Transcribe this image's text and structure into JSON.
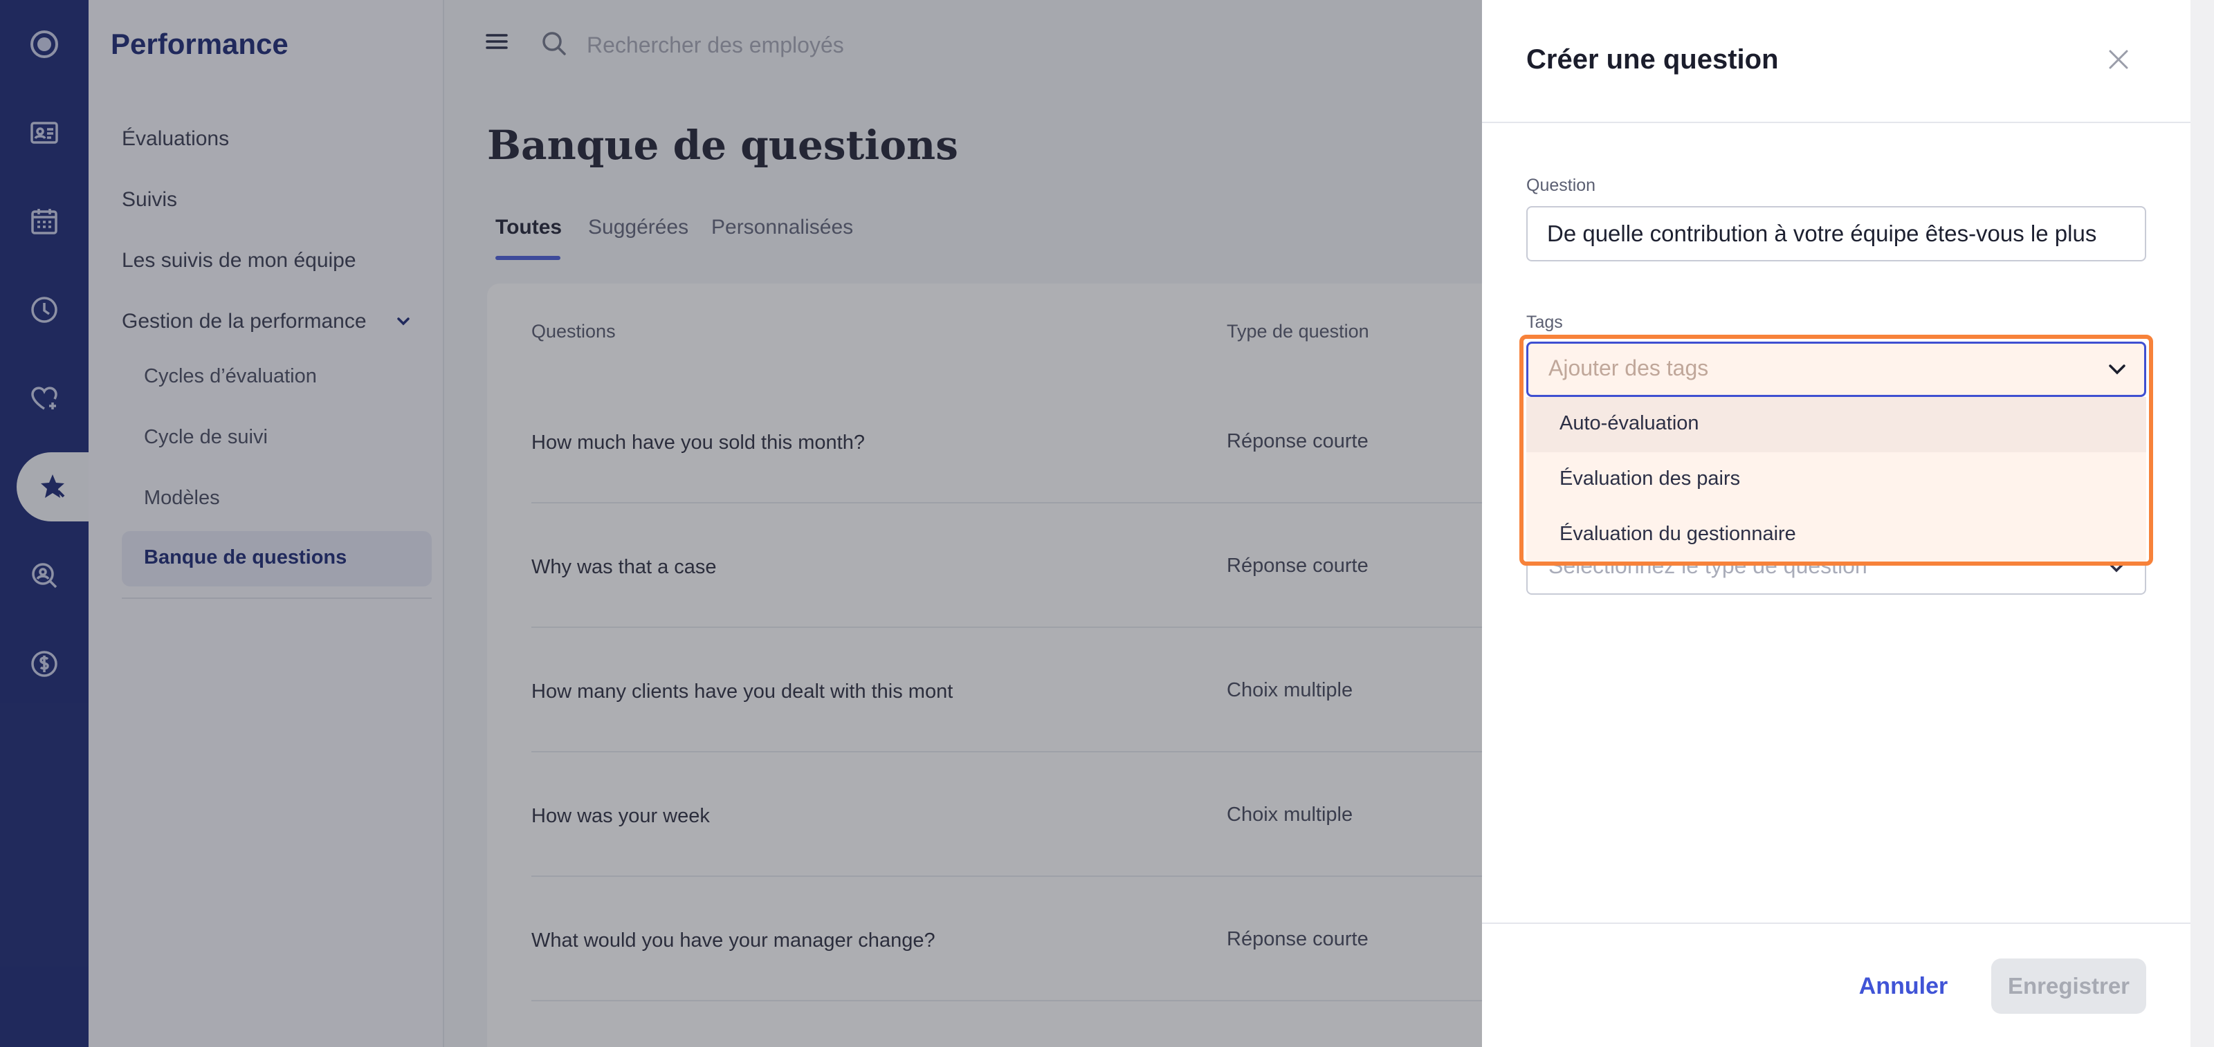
{
  "sidebar": {
    "title": "Performance",
    "items": [
      {
        "label": "Évaluations"
      },
      {
        "label": "Suivis"
      },
      {
        "label": "Les suivis de mon équipe"
      },
      {
        "label": "Gestion de la performance"
      }
    ],
    "subitems": [
      {
        "label": "Cycles d’évaluation"
      },
      {
        "label": "Cycle de suivi"
      },
      {
        "label": "Modèles"
      },
      {
        "label": "Banque de questions"
      }
    ]
  },
  "rail": {
    "icons": [
      "logo-icon",
      "id-card-icon",
      "calendar-icon",
      "clock-icon",
      "heart-plus-icon",
      "star-badge-icon",
      "search-person-icon",
      "dollar-icon"
    ]
  },
  "search": {
    "placeholder": "Rechercher des employés"
  },
  "page": {
    "title": "Banque de questions",
    "tabs": [
      {
        "label": "Toutes"
      },
      {
        "label": "Suggérées"
      },
      {
        "label": "Personnalisées"
      }
    ]
  },
  "table": {
    "headers": [
      "Questions",
      "Type de question"
    ],
    "rows": [
      {
        "question": "How much have you sold this month?",
        "type": "Réponse courte"
      },
      {
        "question": "Why was that a case",
        "type": "Réponse courte"
      },
      {
        "question": "How many clients have you dealt with this mont",
        "type": "Choix multiple"
      },
      {
        "question": "How was your week",
        "type": "Choix multiple"
      },
      {
        "question": "What would you have your manager change?",
        "type": "Réponse courte"
      }
    ]
  },
  "drawer": {
    "title": "Créer une question",
    "question_label": "Question",
    "question_value": "De quelle contribution à votre équipe êtes-vous le plus",
    "tags_label": "Tags",
    "tags_placeholder": "Ajouter des tags",
    "tag_options": [
      "Auto-évaluation",
      "Évaluation des pairs",
      "Évaluation du gestionnaire"
    ],
    "type_placeholder": "Sélectionnez le type de question",
    "cancel_label": "Annuler",
    "save_label": "Enregistrer"
  },
  "colors": {
    "rail": "#0d1b6b",
    "accent": "#4054d6",
    "highlight": "#f7823a"
  }
}
